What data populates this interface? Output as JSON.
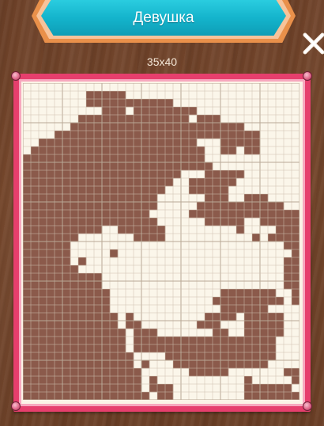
{
  "title": "Девушка",
  "size_label": "35x40",
  "close_label": "close",
  "puzzle": {
    "cols": 35,
    "rows": 40,
    "filled_color": "#8b5a4b",
    "empty_color": "#fbf6ea",
    "grid_line_color": "#cdbfae",
    "major_line_color": "#b8a896",
    "cells": [
      "...................................",
      "........#####......................",
      "........###########................",
      "..........###.########.............",
      ".......##############.###..........",
      "......######################.......",
      "....##########################.....",
      "..####################...#####.....",
      ".######################..##.##.....",
      "#######################............",
      "########################...........",
      "####################...#####.......",
      "###################..######........",
      "##################...#####.........",
      "#################......###..###....",
      "#################.....###########..",
      "################.....##############",
      "#################......#####..#####",
      "##########..######.........#....###",
      "#######.......####...........#.####",
      "######...........................##",
      "######.....#......................#",
      "######.#.........................##",
      "#######..........................##",
      "##########.......................##",
      "##########.......................##",
      "###########..............#######..#",
      "###########.............#########.#",
      "###########..............######....",
      "############.#.........####.#####..",
      "############.##.......###...#####..",
      "#############.###.......##..#####..",
      "#############.##################...",
      "#############.##################...",
      "##############....##############...",
      "##############.#...############....",
      "###############......#####.......##",
      "###############.#...........#.....#",
      "###############.###.........######.",
      "################.##.........#######"
    ]
  }
}
